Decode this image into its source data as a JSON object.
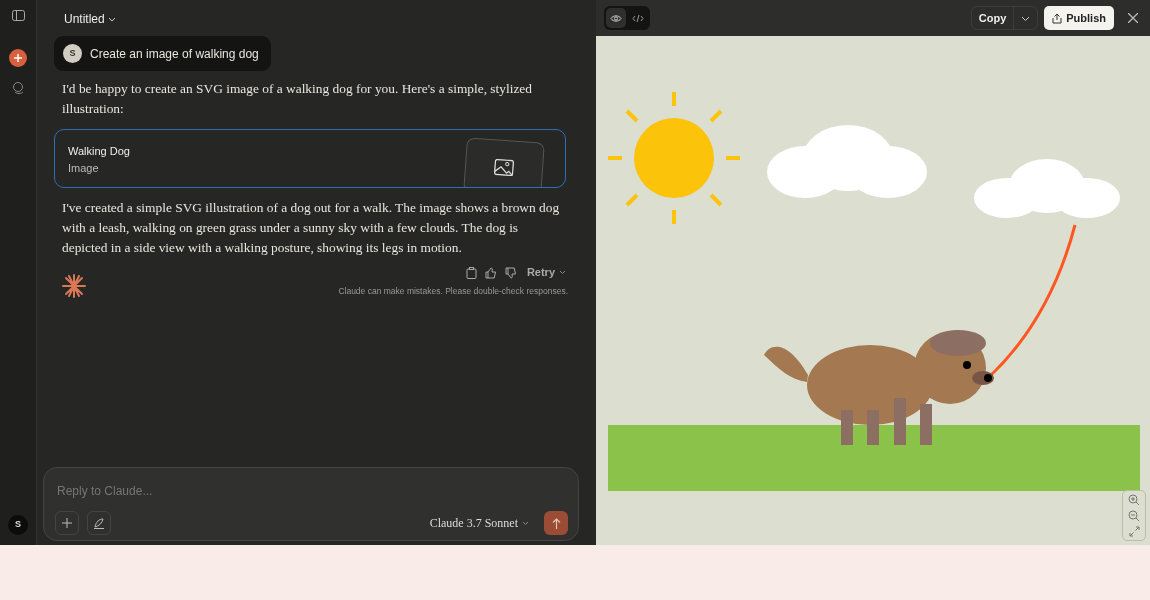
{
  "window": {
    "title": "Untitled"
  },
  "sidebar": {
    "user_avatar": "S"
  },
  "user_message": {
    "avatar": "S",
    "text": "Create an image of walking dog"
  },
  "response_intro": "I'd be happy to create an SVG image of a walking dog for you. Here's a simple, stylized illustration:",
  "artifact": {
    "title": "Walking Dog",
    "type": "Image"
  },
  "response_text": "I've created a simple SVG illustration of a dog out for a walk. The image shows a brown dog with a leash, walking on green grass under a sunny sky with a few clouds. The dog is depicted in a side view with a walking posture, showing its legs in motion.",
  "actions": {
    "retry": "Retry"
  },
  "disclaimer": "Claude can make mistakes. Please double-check responses.",
  "composer": {
    "placeholder": "Reply to Claude...",
    "model": "Claude 3.7 Sonnet"
  },
  "viewer": {
    "tabs": [
      {
        "kind": "preview",
        "selected": true
      },
      {
        "kind": "code",
        "selected": false
      }
    ],
    "copy": "Copy",
    "publish": "Publish"
  }
}
